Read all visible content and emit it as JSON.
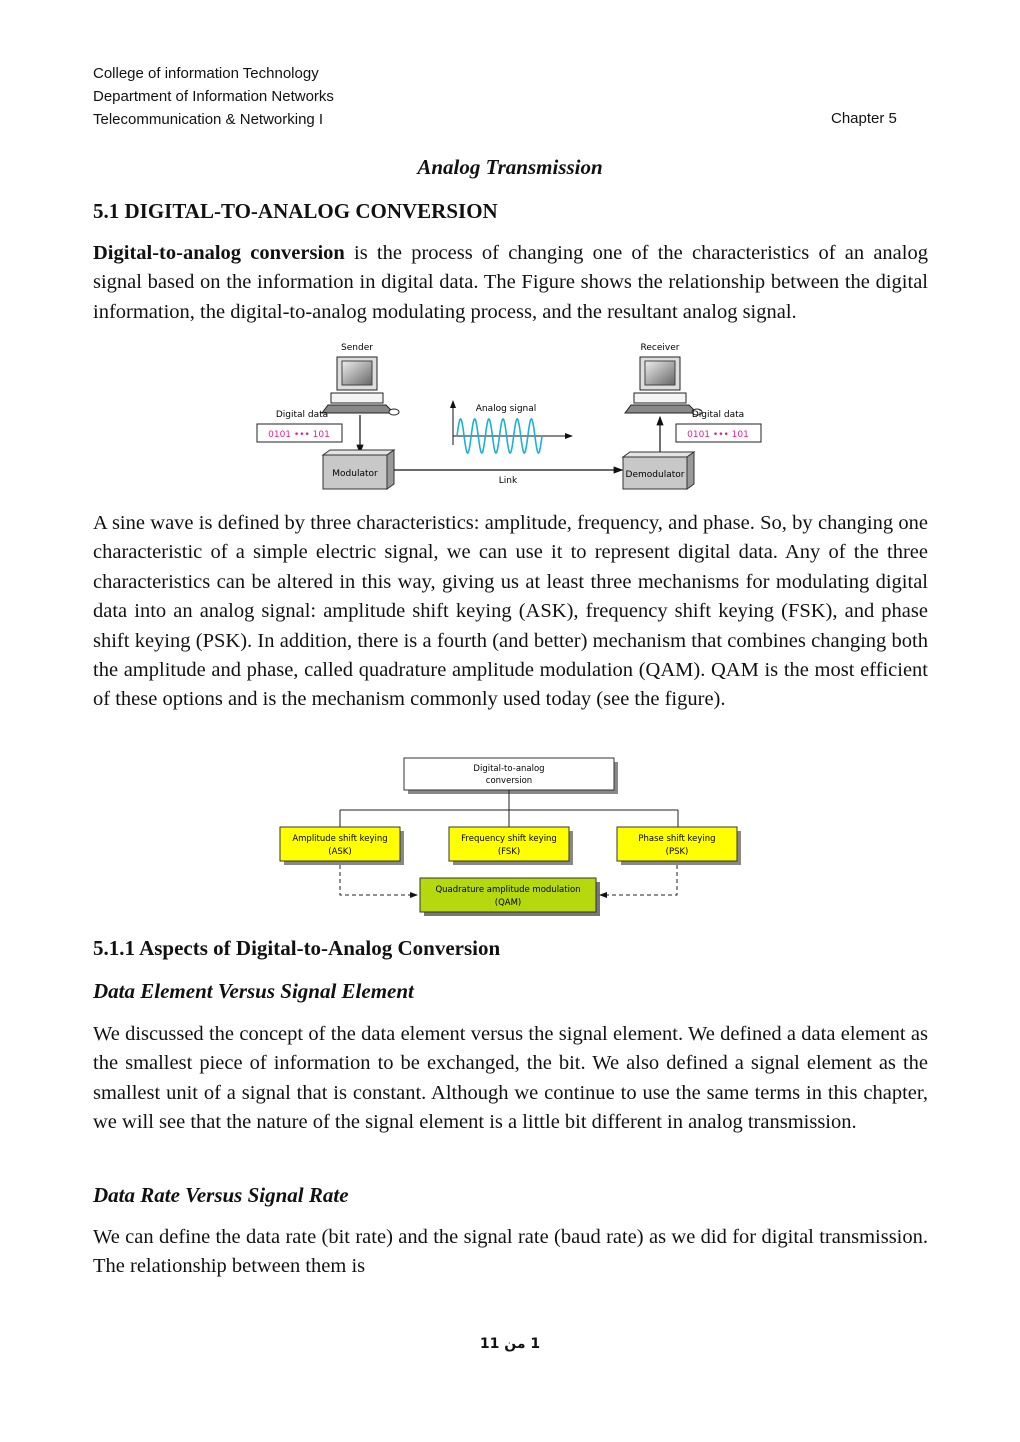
{
  "header": {
    "line1": "College of information Technology",
    "line2": "Department of Information Networks",
    "line3": "Telecommunication & Networking I",
    "chapter": "Chapter 5"
  },
  "title": "Analog Transmission",
  "section_5_1": {
    "heading": "5.1 DIGITAL-TO-ANALOG CONVERSION",
    "intro_bold": "Digital-to-analog conversion",
    "intro_rest": " is the process of changing one of the characteristics of an analog signal based on the information in digital data. The Figure shows the relationship between the digital information, the digital-to-analog modulating process, and the resultant analog signal."
  },
  "figure1": {
    "sender_label": "Sender",
    "receiver_label": "Receiver",
    "digital_data_label": "Digital data",
    "digital_data_value": "0101 ••• 101",
    "analog_signal_label": "Analog signal",
    "modulator_label": "Modulator",
    "demodulator_label": "Demodulator",
    "link_label": "Link",
    "colors": {
      "data_text": "#e0218a",
      "wave": "#1ab0d8",
      "box": "#c8c8c8"
    }
  },
  "paragraph2": "A sine wave is defined by three characteristics: amplitude, frequency, and phase. So, by changing one characteristic of a simple electric signal, we can use it to represent digital data. Any of the three characteristics can be altered in this way, giving us at least three mechanisms for modulating digital data into an analog signal: amplitude shift keying (ASK), frequency shift keying (FSK), and phase shift keying (PSK). In addition, there is a fourth (and better) mechanism that combines changing both the amplitude and phase, called quadrature amplitude modulation (QAM). QAM is the most efficient of these options and is the mechanism commonly used today (see the figure).",
  "figure2": {
    "root_line1": "Digital-to-analog",
    "root_line2": "conversion",
    "ask_line1": "Amplitude shift keying",
    "ask_line2": "(ASK)",
    "fsk_line1": "Frequency shift keying",
    "fsk_line2": "(FSK)",
    "psk_line1": "Phase shift keying",
    "psk_line2": "(PSK)",
    "qam_line1": "Quadrature amplitude modulation",
    "qam_line2": "(QAM)",
    "colors": {
      "yellow": "#ffff00",
      "green": "#b5d80f"
    }
  },
  "section_5_1_1": {
    "heading": "5.1.1 Aspects of Digital-to-Analog Conversion",
    "sub1_heading": "Data Element Versus Signal Element",
    "sub1_text": "We discussed the concept of the data element versus the signal element. We defined a data element as the smallest piece of information to be exchanged, the bit. We also defined a signal element as the smallest unit of a signal that is constant. Although we continue to use the same terms in this chapter, we will see that the nature of the signal element is a little bit different in analog transmission.",
    "sub2_heading": "Data Rate Versus Signal Rate",
    "sub2_text": "We can define the data rate (bit rate) and the signal rate (baud rate) as we did for digital transmission. The relationship between them is"
  },
  "footer": {
    "page_text": "1 من 11"
  }
}
